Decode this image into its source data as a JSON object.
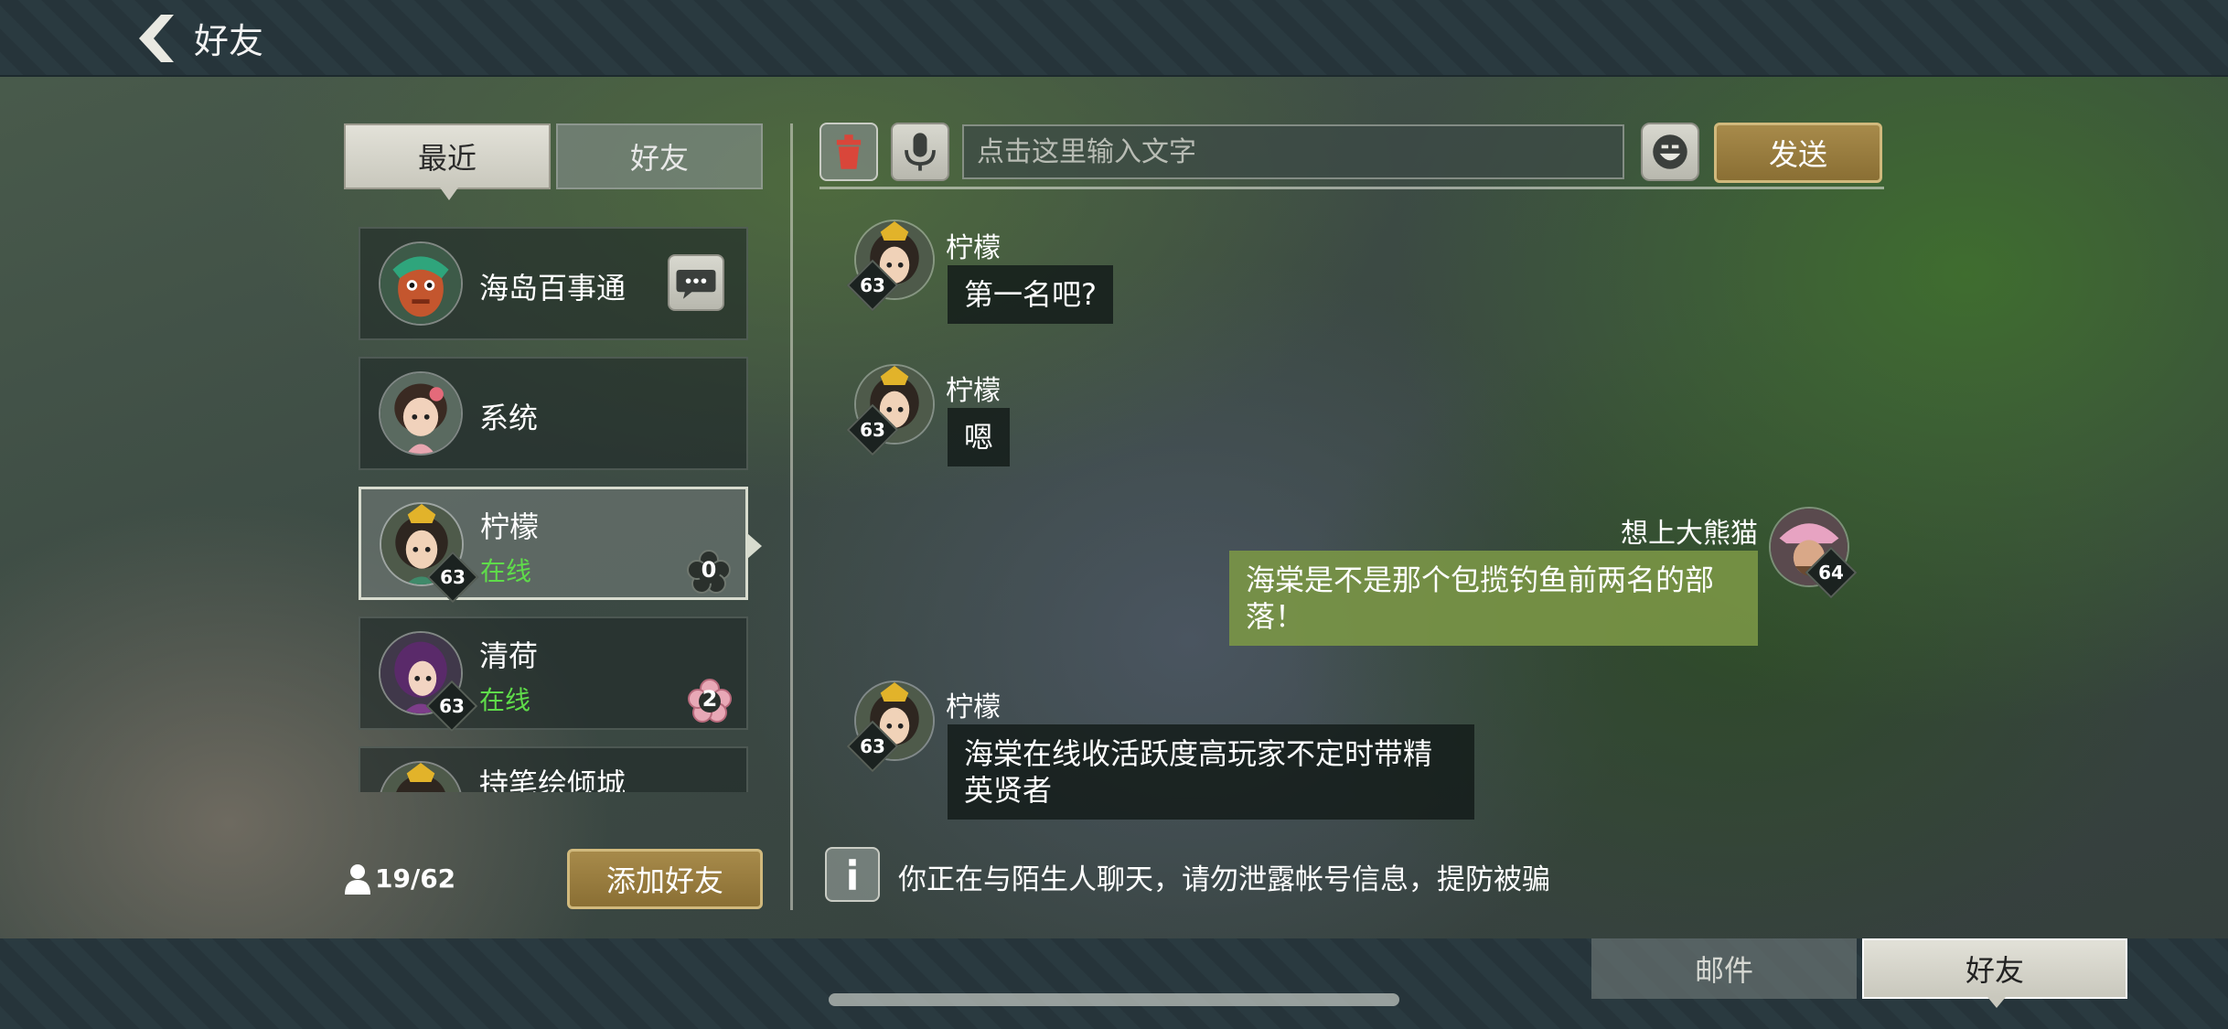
{
  "header": {
    "title": "好友"
  },
  "tabs": {
    "recent": "最近",
    "friends": "好友"
  },
  "contacts": [
    {
      "name": "海岛百事通"
    },
    {
      "name": "系统"
    },
    {
      "name": "柠檬",
      "status": "在线",
      "level": "63",
      "badge": "0"
    },
    {
      "name": "清荷",
      "status": "在线",
      "level": "63",
      "badge": "2"
    },
    {
      "name": "持笔绘倾城"
    }
  ],
  "footer_left": {
    "friend_count": "19/62",
    "add_friend_label": "添加好友"
  },
  "input": {
    "placeholder": "点击这里输入文字",
    "send_label": "发送"
  },
  "messages": [
    {
      "sender": "柠檬",
      "level": "63",
      "text": "第一名吧?"
    },
    {
      "sender": "柠檬",
      "level": "63",
      "text": "嗯"
    },
    {
      "sender": "想上大熊猫",
      "level": "64",
      "text": "海棠是不是那个包揽钓鱼前两名的部落！",
      "mine": true
    },
    {
      "sender": "柠檬",
      "level": "63",
      "text": "海棠在线收活跃度高玩家不定时带精英贤者"
    }
  ],
  "notice": "你正在与陌生人聊天，请勿泄露帐号信息，提防被骗",
  "bottom_tabs": {
    "mail": "邮件",
    "friends": "好友"
  },
  "colors": {
    "online": "#5fdc4a",
    "gold_button": "#8a6f34",
    "my_bubble": "#7a9646"
  }
}
